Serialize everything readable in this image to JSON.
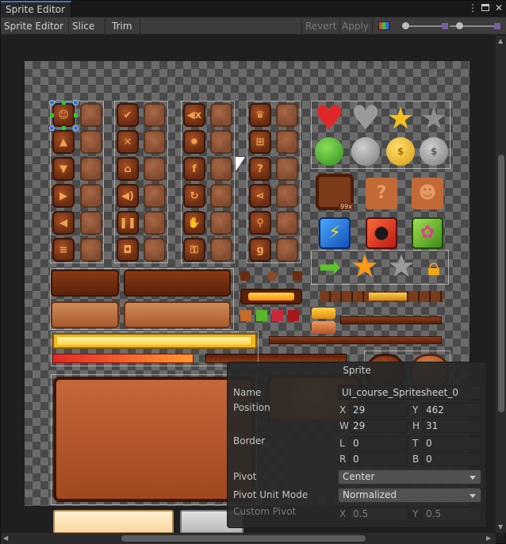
{
  "window": {
    "tab_title": "Sprite Editor"
  },
  "toolbar": {
    "sprite_editor_menu": "Sprite Editor",
    "slice_menu": "Slice",
    "trim_label": "Trim",
    "revert_label": "Revert",
    "apply_label": "Apply"
  },
  "icons": [
    "kebab-menu-icon",
    "maximize-icon",
    "close-icon",
    "rgb-channel-icon",
    "zoom-slider-icon",
    "mip-slider-icon"
  ],
  "colors": {
    "accent_tab": "#3a79bb",
    "selection_outline": "#4a90e2",
    "selection_handle": "#2ccc2c"
  },
  "inspector": {
    "title": "Sprite",
    "name_label": "Name",
    "name_value": "UI_course_Spritesheet_0",
    "position_label": "Position",
    "x_label": "X",
    "x_value": "29",
    "y_label": "Y",
    "y_value": "462",
    "w_label": "W",
    "w_value": "29",
    "h_label": "H",
    "h_value": "31",
    "border_label": "Border",
    "l_label": "L",
    "l_value": "0",
    "t_label": "T",
    "t_value": "0",
    "r_label": "R",
    "r_value": "0",
    "b_label": "B",
    "b_value": "0",
    "pivot_label": "Pivot",
    "pivot_value": "Center",
    "pivot_unit_label": "Pivot Unit Mode",
    "pivot_unit_value": "Normalized",
    "custom_pivot_label": "Custom Pivot",
    "cp_x_label": "X",
    "cp_x_value": "0.5",
    "cp_y_label": "Y",
    "cp_y_value": "0.5"
  },
  "sheet": {
    "badge_text": "99x"
  }
}
